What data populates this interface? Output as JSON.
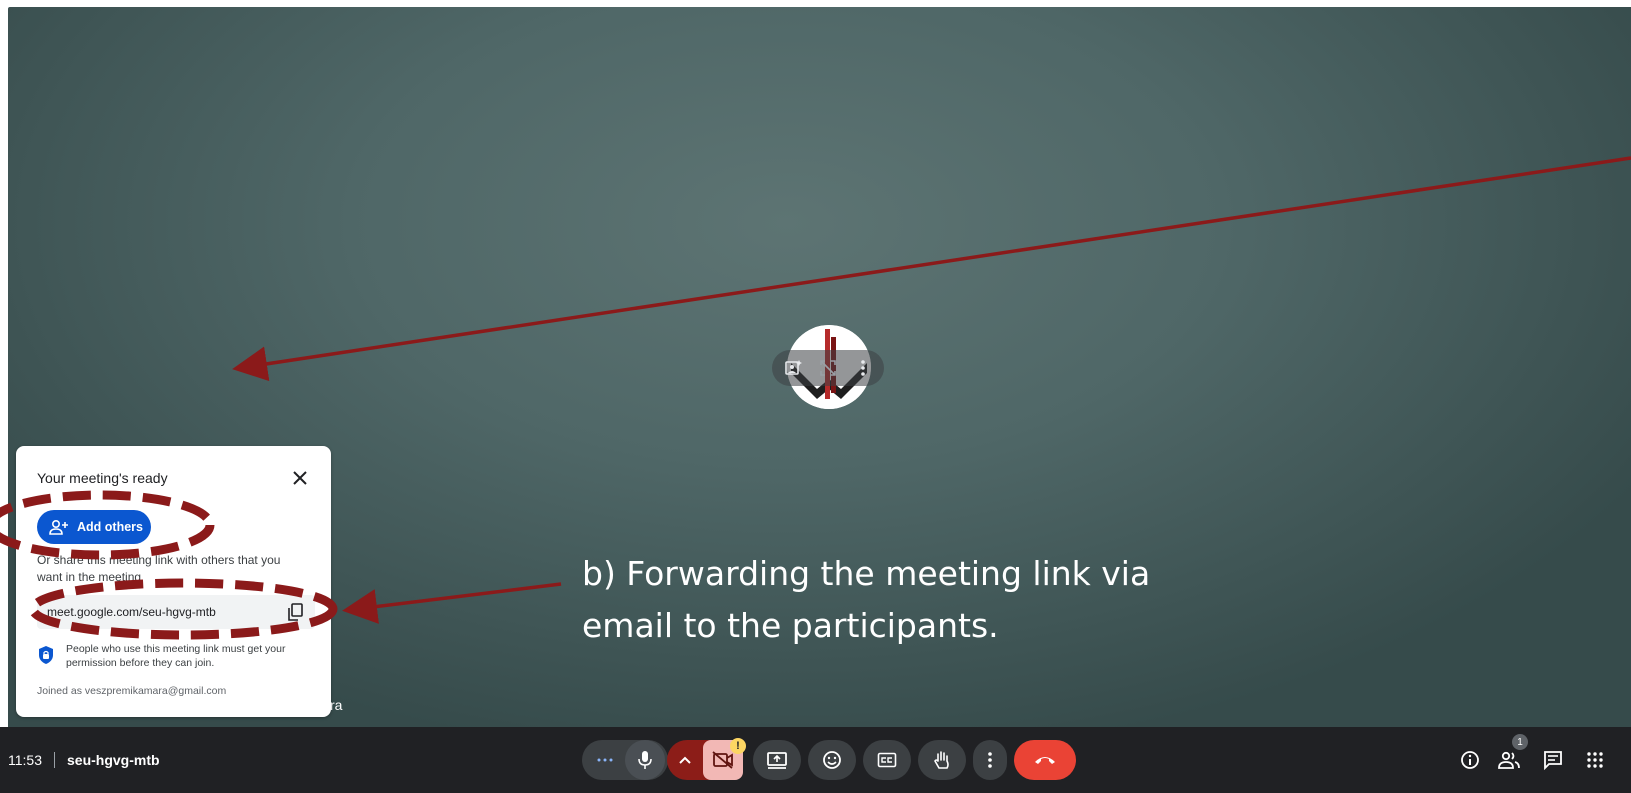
{
  "popup": {
    "title": "Your meeting's ready",
    "add_button_label": "Add others",
    "share_text": "Or share this meeting link with others that you want in the meeting",
    "meeting_link": "meet.google.com/seu-hgvg-mtb",
    "permission_text": "People who use this meeting link must get your permission before they can join.",
    "joined_as": "Joined as veszpremikamara@gmail.com"
  },
  "tile": {
    "name_fragment": "ra"
  },
  "annotation": {
    "text": "b) Forwarding the meeting link via email to the participants.",
    "color": "#8b1a1a"
  },
  "bottom_bar": {
    "time": "11:53",
    "meeting_code": "seu-hgvg-mtb",
    "camera_warning": "!",
    "participants_count": "1"
  },
  "colors": {
    "background": "#4f6767",
    "bar": "#202124",
    "hangup": "#ea4335",
    "primary": "#0b57d0"
  },
  "icons": [
    "more-options-icon",
    "mic-icon",
    "chevron-up-icon",
    "camera-off-icon",
    "present-icon",
    "emoji-icon",
    "captions-icon",
    "raise-hand-icon",
    "more-vert-icon",
    "hangup-icon",
    "info-icon",
    "people-icon",
    "chat-icon",
    "apps-icon"
  ]
}
